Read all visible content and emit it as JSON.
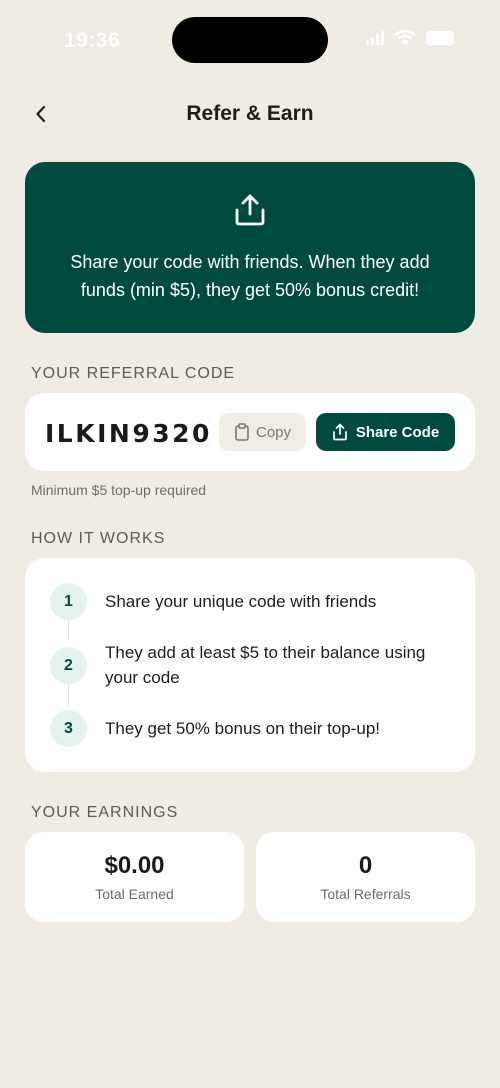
{
  "status_bar": {
    "time": "19:36"
  },
  "header": {
    "title": "Refer & Earn"
  },
  "hero": {
    "text": "Share your code with friends. When they add funds (min $5), they get 50% bonus credit!"
  },
  "referral": {
    "section_label": "YOUR REFERRAL CODE",
    "code": "ILKIN9320",
    "copy_label": "Copy",
    "share_label": "Share Code",
    "note": "Minimum $5 top-up required"
  },
  "how_it_works": {
    "section_label": "HOW IT WORKS",
    "steps": [
      {
        "number": "1",
        "text": "Share your unique code with friends"
      },
      {
        "number": "2",
        "text": "They add at least $5 to their balance using your code"
      },
      {
        "number": "3",
        "text": "They get 50% bonus on their top-up!"
      }
    ]
  },
  "earnings": {
    "section_label": "YOUR EARNINGS",
    "total_earned": {
      "value": "$0.00",
      "label": "Total Earned"
    },
    "total_referrals": {
      "value": "0",
      "label": "Total Referrals"
    }
  },
  "colors": {
    "accent": "#004A3F",
    "background": "#F1ECE3",
    "card": "#FFFFFF"
  }
}
